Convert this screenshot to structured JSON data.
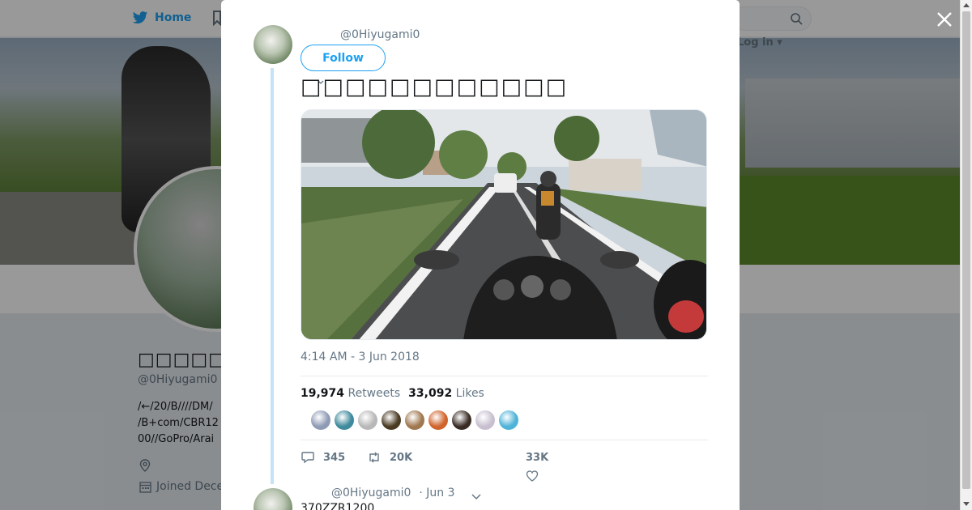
{
  "nav": {
    "home_label": "Home",
    "login_label": "Log in"
  },
  "profile": {
    "name": "□□□□□□□□",
    "handle": "@0Hiyugami0",
    "bio_lines": [
      "/←/20/B////DM/",
      "/B+com/CBR12",
      "00//GoPro/Arai"
    ],
    "joined": "Joined Dece"
  },
  "tweet": {
    "handle": "@0Hiyugami0",
    "follow_label": "Follow",
    "text": "□□□□□□□□□□□□",
    "timestamp": "4:14 AM - 3 Jun 2018",
    "retweets_count": "19,974",
    "retweets_label": "Retweets",
    "likes_count": "33,092",
    "likes_label": "Likes",
    "replies_action": "345",
    "retweets_action": "20K",
    "likes_action": "33K"
  },
  "reply": {
    "handle": "@0Hiyugami0",
    "date": "· Jun 3",
    "text": "370ZZR1200"
  },
  "colors": {
    "accent": "#1da1f2",
    "muted": "#657786",
    "thread_line": "#c4e3f5"
  },
  "likers": [
    {
      "name": "liker-1",
      "color": "#8f9bb5"
    },
    {
      "name": "liker-2",
      "color": "#3f8a9c"
    },
    {
      "name": "liker-3",
      "color": "#b8b8b8"
    },
    {
      "name": "liker-4",
      "color": "#4a3a22"
    },
    {
      "name": "liker-5",
      "color": "#a07850"
    },
    {
      "name": "liker-6",
      "color": "#d0642c"
    },
    {
      "name": "liker-7",
      "color": "#3a2c25"
    },
    {
      "name": "liker-8",
      "color": "#c8c0d0"
    },
    {
      "name": "liker-9",
      "color": "#4fb3d8"
    }
  ]
}
